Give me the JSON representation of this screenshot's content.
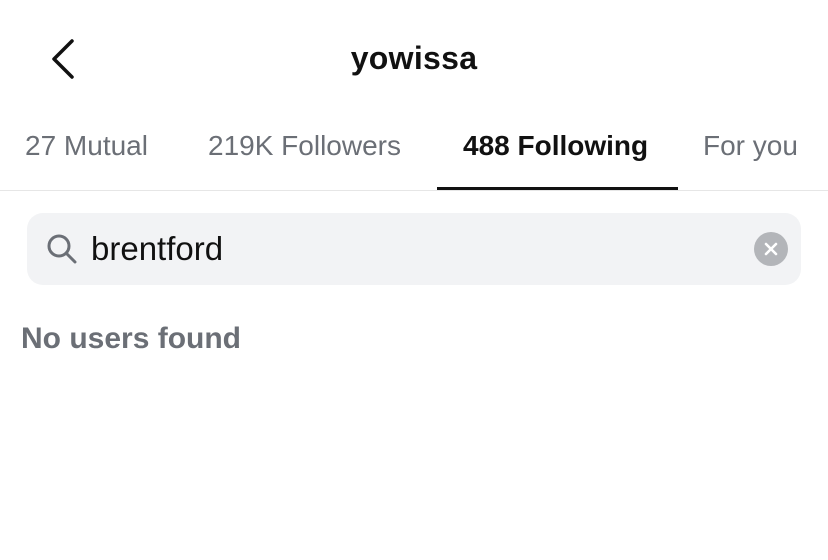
{
  "header": {
    "title": "yowissa",
    "back_icon": "chevron-left-icon"
  },
  "tabs": [
    {
      "label": "27 Mutual",
      "active": false
    },
    {
      "label": "219K Followers",
      "active": false
    },
    {
      "label": "488 Following",
      "active": true
    },
    {
      "label": "For you",
      "active": false
    }
  ],
  "search": {
    "value": "brentford",
    "search_icon": "search-icon",
    "clear_icon": "clear-icon"
  },
  "results": {
    "empty_message": "No users found"
  },
  "colors": {
    "text_primary": "#111111",
    "text_secondary": "#6b6f76",
    "search_background": "#f2f3f5",
    "clear_button": "#b3b5b9",
    "divider": "#e6e6e6"
  }
}
